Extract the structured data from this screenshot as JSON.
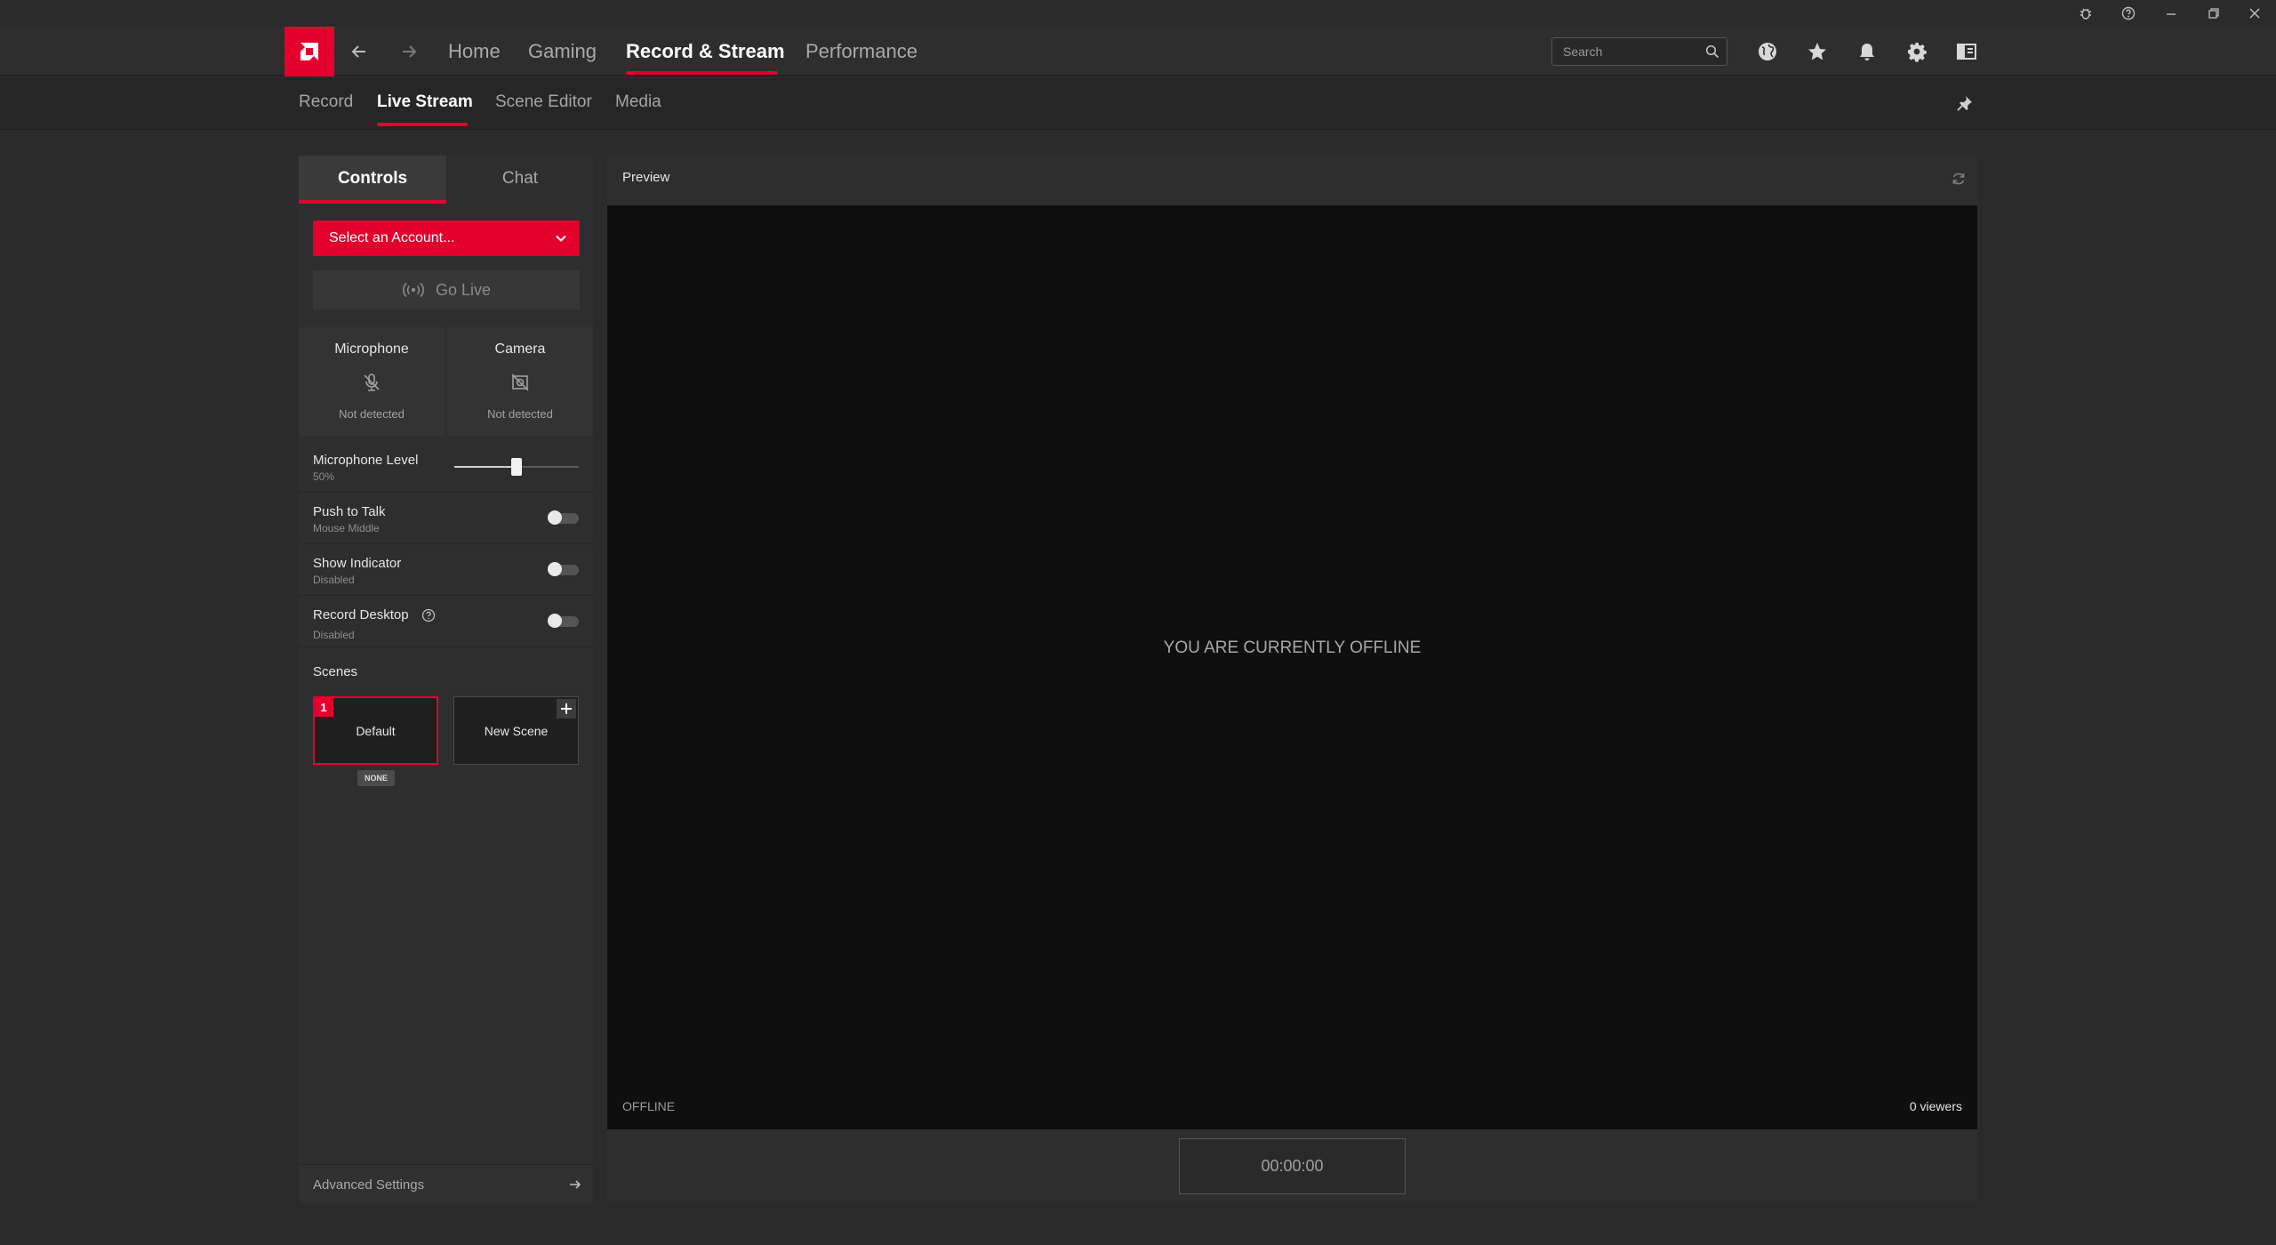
{
  "header": {
    "nav": [
      "Home",
      "Gaming",
      "Record & Stream",
      "Performance"
    ],
    "active_nav": "Record & Stream",
    "search_placeholder": "Search"
  },
  "subnav": {
    "tabs": [
      "Record",
      "Live Stream",
      "Scene Editor",
      "Media"
    ],
    "active": "Live Stream"
  },
  "panel": {
    "tabs": [
      "Controls",
      "Chat"
    ],
    "account_select": "Select an Account...",
    "go_live": "Go Live",
    "microphone": {
      "title": "Microphone",
      "status": "Not detected"
    },
    "camera": {
      "title": "Camera",
      "status": "Not detected"
    },
    "mic_level": {
      "label": "Microphone Level",
      "value_text": "50%",
      "value": 0.5
    },
    "push_to_talk": {
      "label": "Push to Talk",
      "sub": "Mouse Middle",
      "on": false
    },
    "show_indicator": {
      "label": "Show Indicator",
      "sub": "Disabled",
      "on": false
    },
    "record_desktop": {
      "label": "Record Desktop",
      "sub": "Disabled",
      "on": false
    },
    "scenes_title": "Scenes",
    "scenes": [
      {
        "number": "1",
        "name": "Default",
        "badge": "NONE"
      },
      {
        "name": "New Scene"
      }
    ],
    "advanced": "Advanced Settings"
  },
  "preview": {
    "title": "Preview",
    "message": "YOU ARE CURRENTLY OFFLINE",
    "status": "OFFLINE",
    "viewers": "0 viewers",
    "timer": "00:00:00"
  },
  "colors": {
    "accent": "#e3002d",
    "background": "#2b2b2b",
    "panel": "#2e2e2e"
  }
}
